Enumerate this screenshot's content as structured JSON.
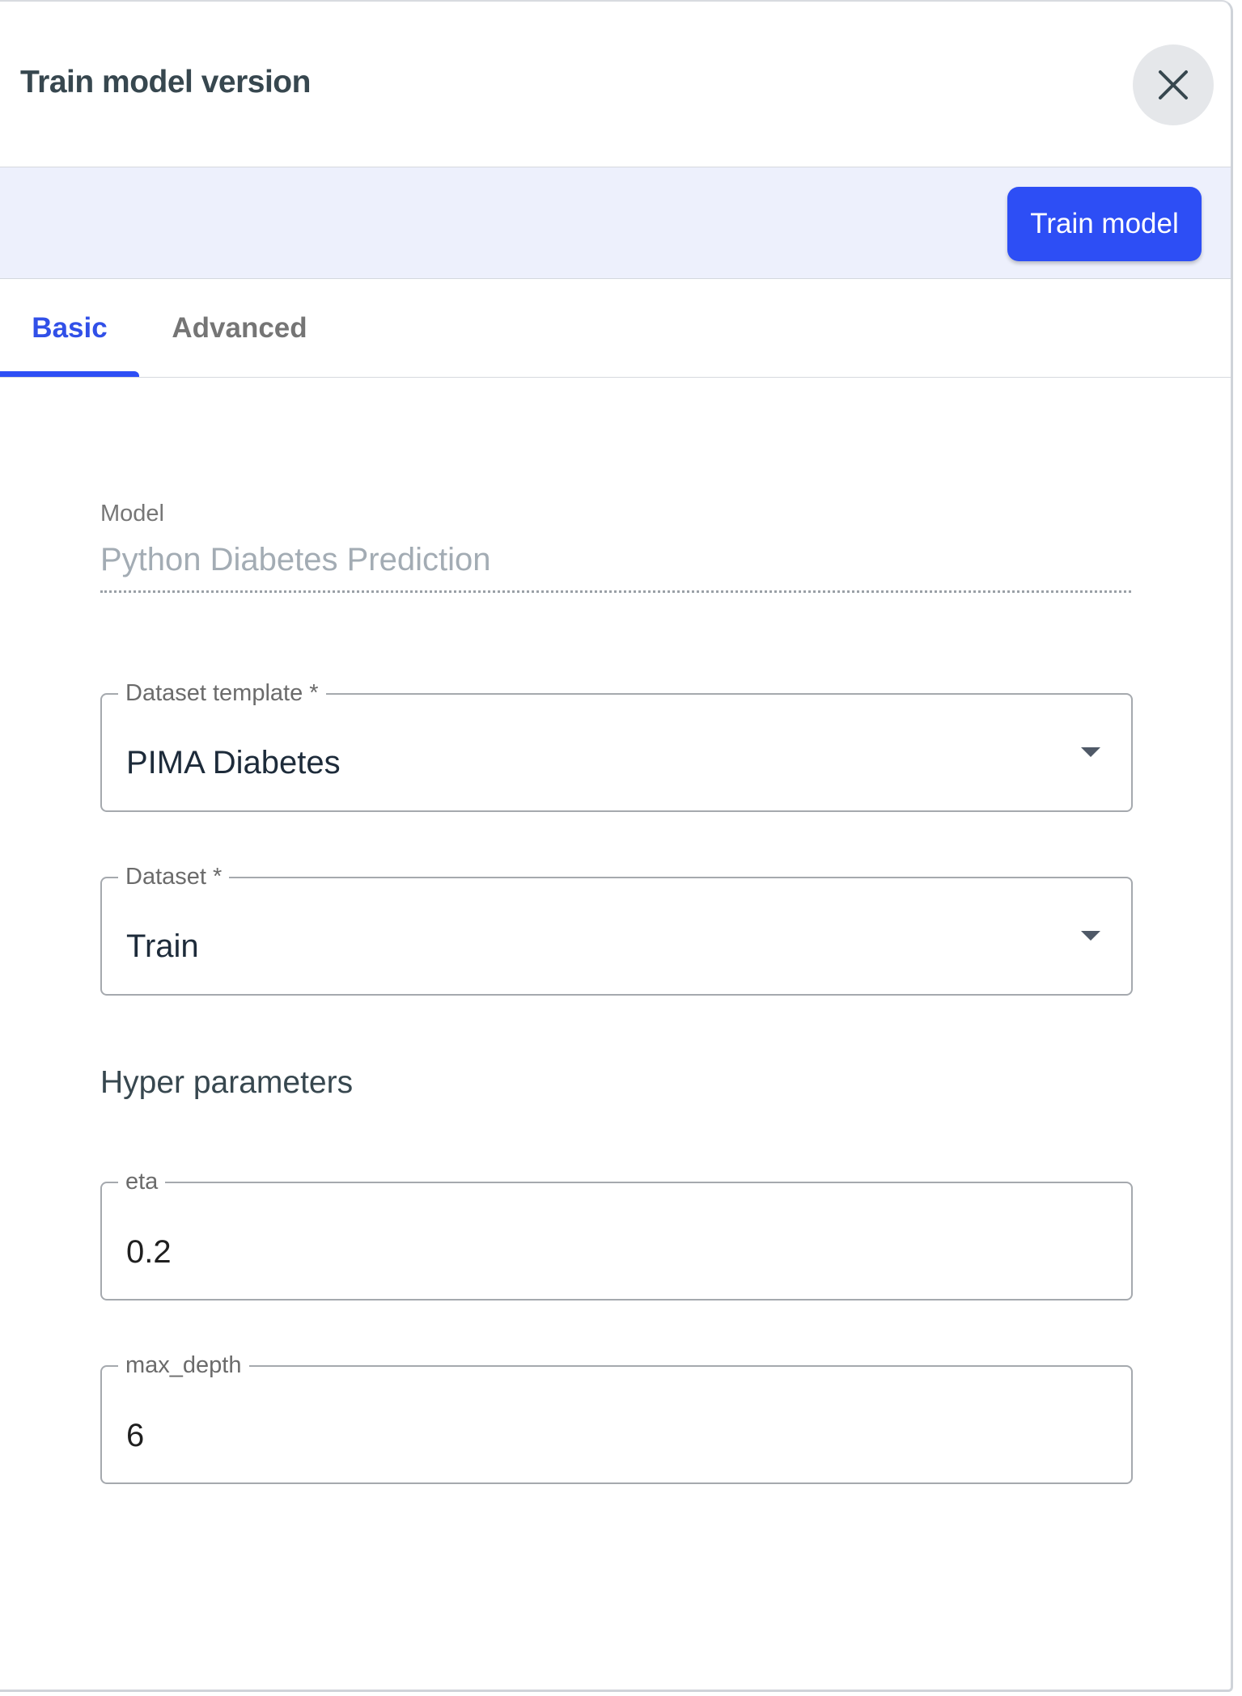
{
  "dialog": {
    "title": "Train model version",
    "close_icon": "close-icon"
  },
  "toolbar": {
    "train_label": "Train model"
  },
  "tabs": [
    {
      "label": "Basic",
      "active": true
    },
    {
      "label": "Advanced",
      "active": false
    }
  ],
  "form": {
    "model": {
      "label": "Model",
      "value": "Python Diabetes Prediction"
    },
    "dataset_template": {
      "label": "Dataset template *",
      "value": "PIMA Diabetes",
      "icon": "chevron-down-icon"
    },
    "dataset": {
      "label": "Dataset *",
      "value": "Train",
      "icon": "chevron-down-icon"
    },
    "hyper_parameters": {
      "heading": "Hyper parameters",
      "eta": {
        "label": "eta",
        "value": "0.2"
      },
      "max_depth": {
        "label": "max_depth",
        "value": "6"
      }
    }
  },
  "colors": {
    "accent": "#2d4ef5",
    "toolbar_bg": "#edf0fc",
    "title_text": "#37474f"
  }
}
